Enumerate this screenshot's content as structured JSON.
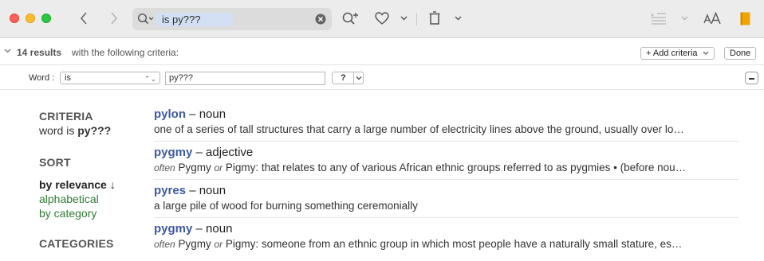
{
  "toolbar": {
    "search_query": "is py???"
  },
  "results_bar": {
    "count_label": "14 results",
    "criteria_text": "with the following criteria:",
    "add_criteria_label": "+ Add criteria",
    "done_label": "Done"
  },
  "criteria_row": {
    "field_label": "Word :",
    "operator_value": "is",
    "pattern_value": "py???",
    "wildcard_value": "?"
  },
  "sidebar": {
    "criteria_heading": "CRITERIA",
    "criteria_prefix": "word is ",
    "criteria_value": "py???",
    "sort_heading": "SORT",
    "sort_active": "by relevance ↓",
    "sort_options": [
      "alphabetical",
      "by category"
    ],
    "categories_heading": "CATEGORIES"
  },
  "results": [
    {
      "word": "pylon",
      "dash": " – ",
      "pos": "noun",
      "definition": "one of a series of tall structures that carry a large number of electricity lines above the ground, usually over lo…"
    },
    {
      "word": "pygmy",
      "dash": " – ",
      "pos": "adjective",
      "note_a": "often",
      "name_a": " Pygmy ",
      "note_b": "or",
      "definition": " Pigmy: that relates to any of various African ethnic groups referred to as pygmies • (before nou…"
    },
    {
      "word": "pyres",
      "dash": " – ",
      "pos": "noun",
      "definition": "a large pile of wood for burning something ceremonially"
    },
    {
      "word": "pygmy",
      "dash": " – ",
      "pos": "noun",
      "note_a": "often",
      "name_a": " Pygmy ",
      "note_b": "or",
      "definition": " Pigmy: someone from an ethnic group in which most people have a naturally small stature, es…"
    }
  ]
}
